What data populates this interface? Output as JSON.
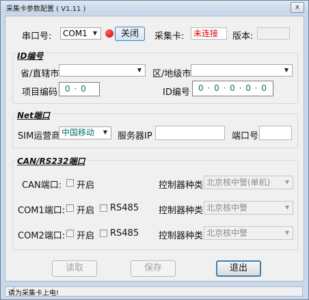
{
  "window": {
    "title": "采集卡参数配置 ( V1.11 )",
    "close_glyph": "x"
  },
  "serial": {
    "port_label": "串口号:",
    "port_value": "COM1",
    "toggle_label": "关闭",
    "indicator_color": "#e00000",
    "card_label": "采集卡:",
    "card_status": "未连接",
    "card_status_color": "#e00000",
    "version_label": "版本:",
    "version_value": ""
  },
  "id_section": {
    "title": "ID编号",
    "province_label": "省/直辖市",
    "province_value": "",
    "district_label": "区/地级市",
    "district_value": "",
    "project_label": "项目编码",
    "project_value": "0 · 0",
    "id_label": "ID编号",
    "id_value": "0 · 0 · 0 · 0 · 0"
  },
  "net_section": {
    "title": "Net端口",
    "sim_label": "SIM运营商",
    "sim_value": "中国移动",
    "server_label": "服务器IP",
    "server_value": "",
    "port_label": "端口号",
    "port_value": ""
  },
  "can_section": {
    "title": "CAN/RS232端口",
    "rows": [
      {
        "port_label": "CAN端口:",
        "enable_label": "开启",
        "rs485_label": "",
        "controller_label": "控制器种类",
        "controller_value": "北京核中警(单机)"
      },
      {
        "port_label": "COM1端口:",
        "enable_label": "开启",
        "rs485_label": "RS485",
        "controller_label": "控制器种类",
        "controller_value": "北京核中警"
      },
      {
        "port_label": "COM2端口:",
        "enable_label": "开启",
        "rs485_label": "RS485",
        "controller_label": "控制器种类",
        "controller_value": "北京核中警"
      }
    ]
  },
  "buttons": {
    "read": "读取",
    "save": "保存",
    "exit": "退出"
  },
  "status_bar": {
    "text": "请为采集卡上电!"
  },
  "icons": {
    "dropdown": "chevron-down-icon",
    "indicator": "status-dot-icon"
  }
}
